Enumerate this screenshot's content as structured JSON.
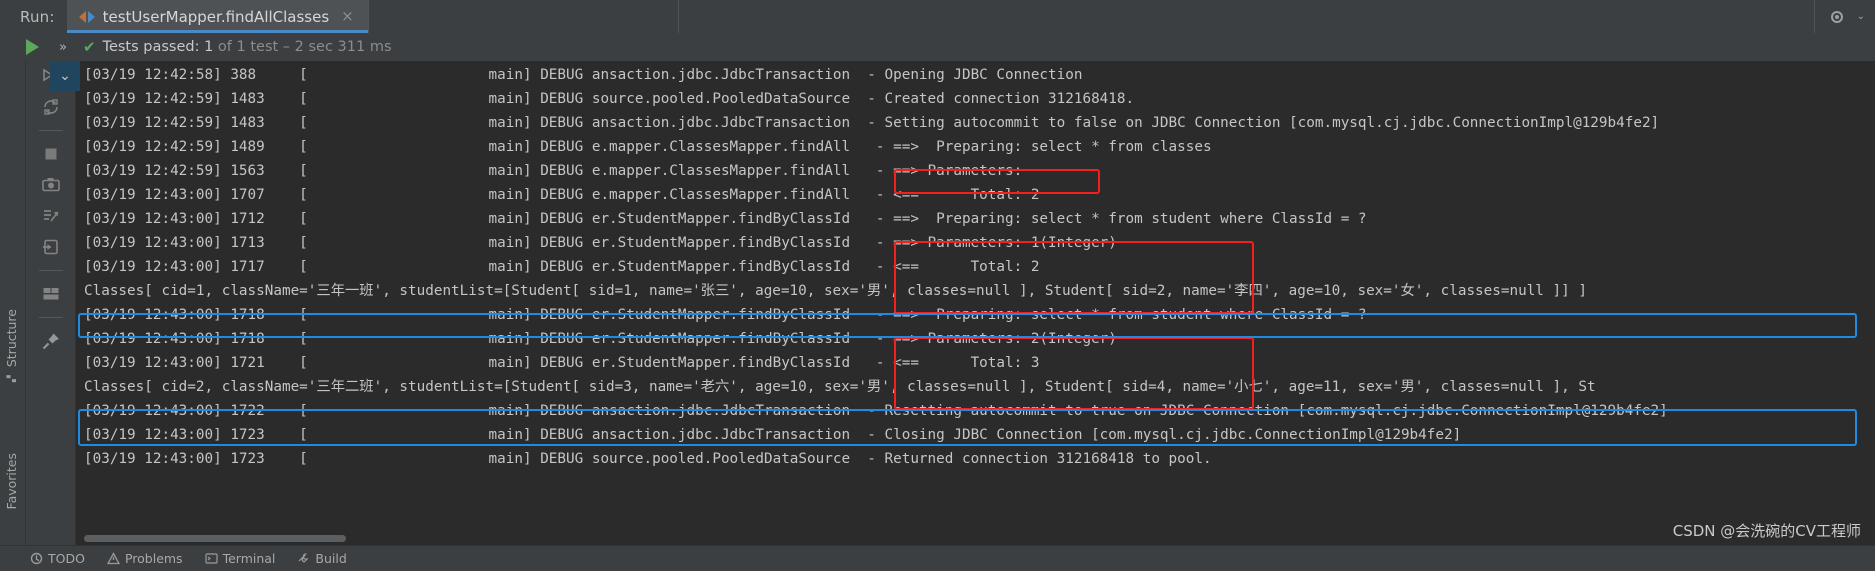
{
  "window": {
    "run_label": "Run:",
    "tab_title": "testUserMapper.findAllClasses",
    "tab_close": "×",
    "settings_icon": "gear-icon",
    "minimize_icon": "⌄"
  },
  "status": {
    "run_icon": "play-icon",
    "expand_icon": "»",
    "check_icon": "✔",
    "text_main": "Tests passed: ",
    "count": "1",
    "text_rest": " of 1 test – 2 sec 311 ms"
  },
  "gutter": {
    "items": [
      {
        "name": "rerun-failed-tests-icon",
        "glyph": "rerun-failed"
      },
      {
        "name": "rerun-auto-icon",
        "glyph": "rerun-auto"
      },
      {
        "name": "stop-icon",
        "glyph": "stop"
      },
      {
        "name": "screenshot-icon",
        "glyph": "camera"
      },
      {
        "name": "export-test-results-icon",
        "glyph": "export"
      },
      {
        "name": "import-test-results-icon",
        "glyph": "import"
      },
      {
        "name": "layout-settings-icon",
        "glyph": "layout"
      },
      {
        "name": "pin-tab-icon",
        "glyph": "pin"
      }
    ]
  },
  "left_strip": {
    "structure_label": "Structure",
    "favorites_label": "Favorites"
  },
  "console": {
    "collapse_icon": "⌄",
    "lines": [
      "[03/19 12:42:58] 388     [                     main] DEBUG ansaction.jdbc.JdbcTransaction  - Opening JDBC Connection",
      "[03/19 12:42:59] 1483    [                     main] DEBUG source.pooled.PooledDataSource  - Created connection 312168418.",
      "[03/19 12:42:59] 1483    [                     main] DEBUG ansaction.jdbc.JdbcTransaction  - Setting autocommit to false on JDBC Connection [com.mysql.cj.jdbc.ConnectionImpl@129b4fe2]",
      "[03/19 12:42:59] 1489    [                     main] DEBUG e.mapper.ClassesMapper.findAll   - ==>  Preparing: select * from classes",
      "[03/19 12:42:59] 1563    [                     main] DEBUG e.mapper.ClassesMapper.findAll   - ==> Parameters:",
      "[03/19 12:43:00] 1707    [                     main] DEBUG e.mapper.ClassesMapper.findAll   - <==      Total: 2",
      "[03/19 12:43:00] 1712    [                     main] DEBUG er.StudentMapper.findByClassId   - ==>  Preparing: select * from student where ClassId = ?",
      "[03/19 12:43:00] 1713    [                     main] DEBUG er.StudentMapper.findByClassId   - ==> Parameters: 1(Integer)",
      "[03/19 12:43:00] 1717    [                     main] DEBUG er.StudentMapper.findByClassId   - <==      Total: 2",
      "Classes[ cid=1, className='三年一班', studentList=[Student[ sid=1, name='张三', age=10, sex='男', classes=null ], Student[ sid=2, name='李四', age=10, sex='女', classes=null ]] ]",
      "[03/19 12:43:00] 1718    [                     main] DEBUG er.StudentMapper.findByClassId   - ==>  Preparing: select * from student where ClassId = ?",
      "[03/19 12:43:00] 1718    [                     main] DEBUG er.StudentMapper.findByClassId   - ==> Parameters: 2(Integer)",
      "[03/19 12:43:00] 1721    [                     main] DEBUG er.StudentMapper.findByClassId   - <==      Total: 3",
      "Classes[ cid=2, className='三年二班', studentList=[Student[ sid=3, name='老六', age=10, sex='男', classes=null ], Student[ sid=4, name='小七', age=11, sex='男', classes=null ], St",
      "[03/19 12:43:00] 1722    [                     main] DEBUG ansaction.jdbc.JdbcTransaction  - Resetting autocommit to true on JDBC Connection [com.mysql.cj.jdbc.ConnectionImpl@129b4fe2]",
      "[03/19 12:43:00] 1723    [                     main] DEBUG ansaction.jdbc.JdbcTransaction  - Closing JDBC Connection [com.mysql.cj.jdbc.ConnectionImpl@129b4fe2]",
      "[03/19 12:43:00] 1723    [                     main] DEBUG source.pooled.PooledDataSource  - Returned connection 312168418 to pool."
    ]
  },
  "annotations": {
    "red_boxes": [
      {
        "name": "sql-highlight-select-classes",
        "text": "select * from classes"
      },
      {
        "name": "sql-highlight-select-student-1",
        "text": "select * from student where ClassId = ?"
      },
      {
        "name": "sql-highlight-select-student-2",
        "text": "select * from student where ClassId = ?"
      }
    ],
    "blue_boxes": [
      {
        "name": "result-highlight-classes-1"
      },
      {
        "name": "result-highlight-classes-2"
      }
    ],
    "colors": {
      "red": "#f41f1f",
      "blue": "#1e8ae0",
      "accent": "#4a88c7",
      "pass_green": "#5ca75c"
    }
  },
  "bottom_bar": {
    "items": [
      {
        "name": "todo-item",
        "label": "TODO"
      },
      {
        "name": "problems-item",
        "label": "Problems"
      },
      {
        "name": "terminal-item",
        "label": "Terminal"
      },
      {
        "name": "build-item",
        "label": "Build"
      }
    ]
  },
  "watermark": {
    "text": "CSDN @会洗碗的CV工程师"
  }
}
